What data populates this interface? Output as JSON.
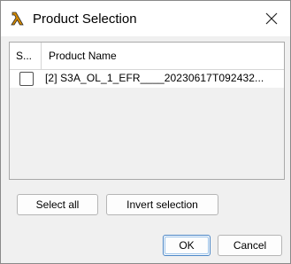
{
  "window": {
    "title": "Product Selection",
    "icon": "lambda-icon",
    "close_icon": "close-icon"
  },
  "table": {
    "columns": [
      "S...",
      "Product Name"
    ],
    "rows": [
      {
        "selected": false,
        "name": "[2] S3A_OL_1_EFR____20230617T092432..."
      }
    ]
  },
  "buttons": {
    "select_all": "Select all",
    "invert_selection": "Invert selection",
    "ok": "OK",
    "cancel": "Cancel"
  },
  "colors": {
    "accent": "#4a86c7",
    "icon_gold": "#d58a00"
  }
}
